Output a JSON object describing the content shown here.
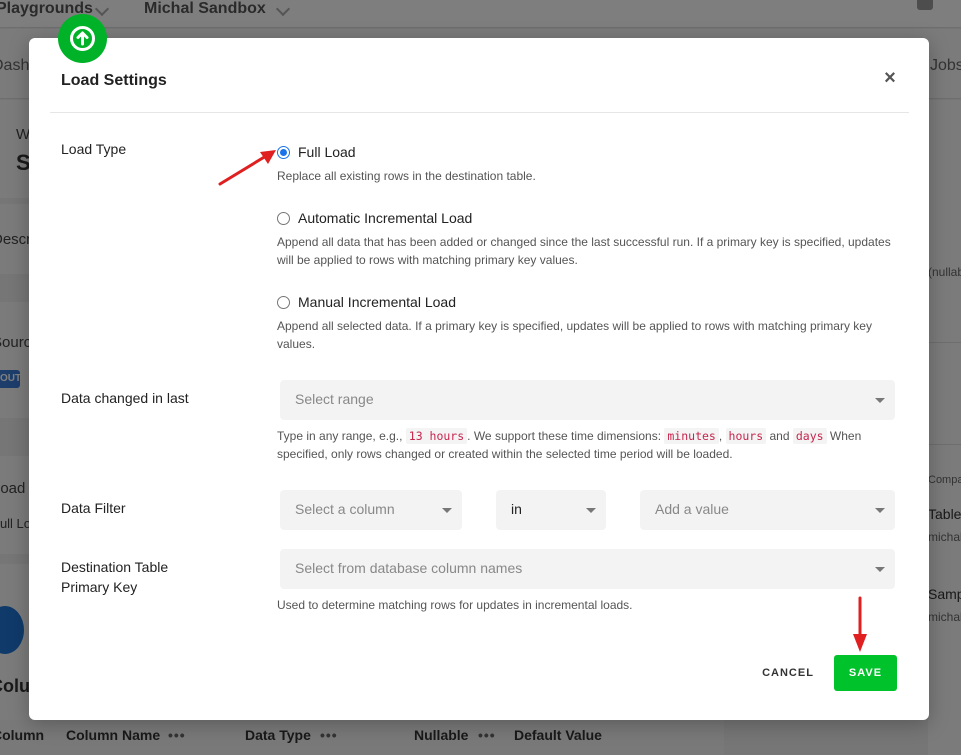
{
  "background": {
    "topbar": {
      "crumb_left": "Playgrounds",
      "crumb_right": "Michal Sandbox"
    },
    "tabs": {
      "left": "Dashboards",
      "right": "Jobs"
    },
    "left_panel": {
      "small_text": "W",
      "title_text": "S",
      "description_text": "Description",
      "source_text": "Source",
      "badge_text": "OUT",
      "load_type_text": "Load Type",
      "load_value_text": "Full Load",
      "columns_text": "Columns"
    },
    "right_panel": {
      "nullable_text": "(nullable)",
      "compare_text": "Compare L",
      "edited_text": "Table edited",
      "edited_user": "michal",
      "sample_text": "Sample",
      "sample_user": "michal"
    },
    "table_header": {
      "col1": "Column",
      "col2": "Column Name",
      "col3": "Data Type",
      "col4": "Nullable",
      "col5": "Default Value",
      "dots": "•••"
    }
  },
  "modal": {
    "title": "Load Settings",
    "close_symbol": "×",
    "load_type": {
      "label": "Load Type",
      "options": [
        {
          "label": "Full Load",
          "help": "Replace all existing rows in the destination table.",
          "checked": true
        },
        {
          "label": "Automatic Incremental Load",
          "help": "Append all data that has been added or changed since the last successful run. If a primary key is specified, updates will be applied to rows with matching primary key values.",
          "checked": false
        },
        {
          "label": "Manual Incremental Load",
          "help": "Append all selected data. If a primary key is specified, updates will be applied to rows with matching primary key values.",
          "checked": false
        }
      ]
    },
    "data_changed": {
      "label": "Data changed in last",
      "placeholder": "Select range",
      "help_prefix": "Type in any range, e.g.,",
      "example_code": "13 hours",
      "help_middle": ". We support these time dimensions:",
      "dim_minutes": "minutes",
      "sep_comma": ",",
      "dim_hours": "hours",
      "word_and": "and",
      "dim_days": "days",
      "help_suffix": "When specified, only rows changed or created within the selected time period will be loaded."
    },
    "data_filter": {
      "label": "Data Filter",
      "column_placeholder": "Select a column",
      "operator_value": "in",
      "value_placeholder": "Add a value"
    },
    "primary_key": {
      "label_line1": "Destination Table",
      "label_line2": "Primary Key",
      "placeholder": "Select from database column names",
      "help": "Used to determine matching rows for updates in incremental loads."
    },
    "buttons": {
      "cancel": "CANCEL",
      "save": "SAVE"
    }
  },
  "colors": {
    "accent_green": "#00c22b",
    "radio_blue": "#1a73e8",
    "annotation_red": "#e02020"
  },
  "icons": {
    "upload": "arrow-up-circle-icon",
    "close": "close-icon",
    "caret": "caret-down-icon"
  }
}
